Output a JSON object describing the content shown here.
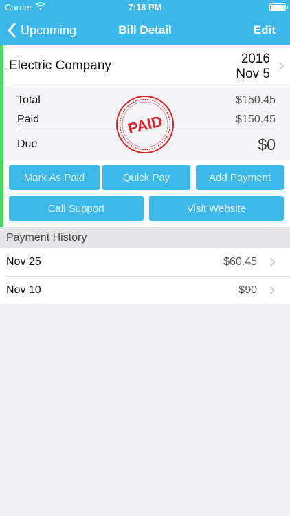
{
  "status_bar": {
    "carrier": "Carrier",
    "time": "7:18 PM"
  },
  "nav": {
    "back_label": "Upcoming",
    "title": "Bill Detail",
    "edit_label": "Edit"
  },
  "bill": {
    "company": "Electric Company",
    "year": "2016",
    "date": "Nov 5",
    "accent_color": "#4cd964",
    "stamp_text": "PAID",
    "total_label": "Total",
    "total_value": "$150.45",
    "paid_label": "Paid",
    "paid_value": "$150.45",
    "due_label": "Due",
    "due_value": "$0"
  },
  "actions": {
    "mark_as_paid": "Mark As Paid",
    "quick_pay": "Quick Pay",
    "add_payment": "Add Payment",
    "call_support": "Call Support",
    "visit_website": "Visit Website"
  },
  "payment_history": {
    "header": "Payment History",
    "items": [
      {
        "date": "Nov 25",
        "amount": "$60.45"
      },
      {
        "date": "Nov 10",
        "amount": "$90"
      }
    ]
  },
  "colors": {
    "brand": "#3bb7e9",
    "button": "#3cb8ea",
    "stamp": "#d8232a"
  },
  "icons": [
    "wifi-icon",
    "battery-icon",
    "back-chevron-icon",
    "chevron-right-icon",
    "paid-stamp"
  ]
}
